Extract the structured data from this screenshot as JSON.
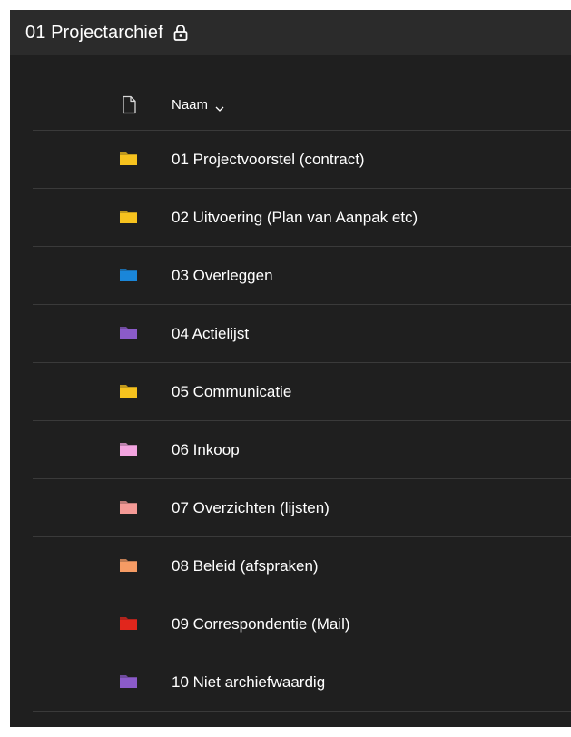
{
  "header": {
    "title": "01 Projectarchief",
    "lock_icon": "lock-icon"
  },
  "columns": {
    "file_type_icon": "document-icon",
    "name_label": "Naam",
    "sort_icon": "chevron-down-icon"
  },
  "items": [
    {
      "label": "01 Projectvoorstel (contract)",
      "icon": "folder-icon",
      "color": "#f6c21e"
    },
    {
      "label": "02 Uitvoering (Plan van Aanpak etc)",
      "icon": "folder-icon",
      "color": "#f6c21e"
    },
    {
      "label": "03 Overleggen",
      "icon": "folder-icon",
      "color": "#1a86d9"
    },
    {
      "label": "04 Actielijst",
      "icon": "folder-icon",
      "color": "#8b5bc9"
    },
    {
      "label": "05 Communicatie",
      "icon": "folder-icon",
      "color": "#f6c21e"
    },
    {
      "label": "06 Inkoop",
      "icon": "folder-icon",
      "color": "#f2a4df"
    },
    {
      "label": "07 Overzichten (lijsten)",
      "icon": "folder-icon",
      "color": "#f49a96"
    },
    {
      "label": "08 Beleid (afspraken)",
      "icon": "folder-icon",
      "color": "#f59b64"
    },
    {
      "label": "09 Correspondentie (Mail)",
      "icon": "folder-icon",
      "color": "#e1261c"
    },
    {
      "label": "10 Niet archiefwaardig",
      "icon": "folder-icon",
      "color": "#8b5bc9"
    }
  ]
}
